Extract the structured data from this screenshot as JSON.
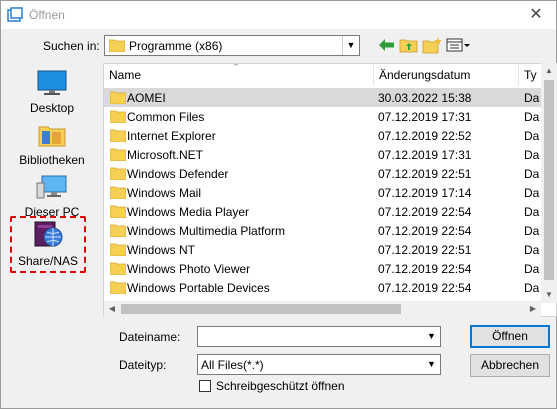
{
  "window": {
    "title": "Öffnen",
    "close_glyph": "✕"
  },
  "lookin": {
    "label": "Suchen in:",
    "value": "Programme (x86)"
  },
  "toolbar": {
    "icons": [
      "back-arrow-icon",
      "up-folder-icon",
      "new-folder-icon",
      "view-menu-icon"
    ]
  },
  "places": [
    {
      "label": "Desktop",
      "icon": "desktop-icon"
    },
    {
      "label": "Bibliotheken",
      "icon": "libraries-icon"
    },
    {
      "label": "Dieser PC",
      "icon": "this-pc-icon"
    },
    {
      "label": "Share/NAS",
      "icon": "share-nas-icon",
      "highlighted": true
    }
  ],
  "columns": {
    "name": "Name",
    "date": "Änderungsdatum",
    "type": "Ty"
  },
  "files": [
    {
      "name": "AOMEI",
      "date": "30.03.2022 15:38",
      "type": "Da",
      "selected": true
    },
    {
      "name": "Common Files",
      "date": "07.12.2019 17:31",
      "type": "Da"
    },
    {
      "name": "Internet Explorer",
      "date": "07.12.2019 22:52",
      "type": "Da"
    },
    {
      "name": "Microsoft.NET",
      "date": "07.12.2019 17:31",
      "type": "Da"
    },
    {
      "name": "Windows Defender",
      "date": "07.12.2019 22:51",
      "type": "Da"
    },
    {
      "name": "Windows Mail",
      "date": "07.12.2019 17:14",
      "type": "Da"
    },
    {
      "name": "Windows Media Player",
      "date": "07.12.2019 22:54",
      "type": "Da"
    },
    {
      "name": "Windows Multimedia Platform",
      "date": "07.12.2019 22:54",
      "type": "Da"
    },
    {
      "name": "Windows NT",
      "date": "07.12.2019 22:51",
      "type": "Da"
    },
    {
      "name": "Windows Photo Viewer",
      "date": "07.12.2019 22:54",
      "type": "Da"
    },
    {
      "name": "Windows Portable Devices",
      "date": "07.12.2019 22:54",
      "type": "Da"
    }
  ],
  "filename": {
    "label": "Dateiname:",
    "value": ""
  },
  "filetype": {
    "label": "Dateityp:",
    "value": "All Files(*.*)"
  },
  "readonly": {
    "label": "Schreibgeschützt öffnen",
    "checked": false
  },
  "buttons": {
    "open": "Öffnen",
    "cancel": "Abbrechen"
  },
  "colors": {
    "accent": "#0078d7",
    "highlight": "#e00000",
    "folder": "#f6cf57",
    "selected_row": "#d9d9d9"
  }
}
